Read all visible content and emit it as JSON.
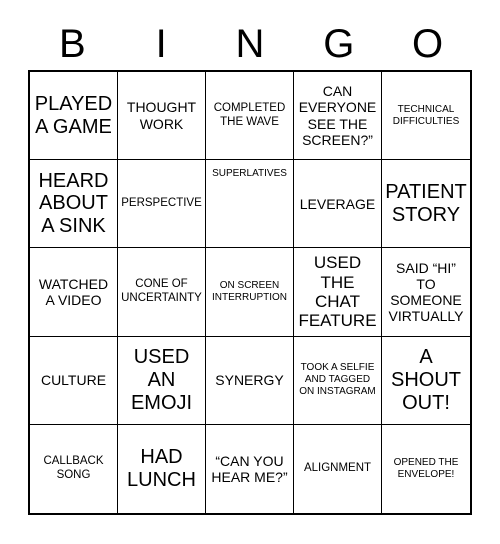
{
  "card": {
    "title": "BINGO",
    "header_letters": [
      "B",
      "I",
      "N",
      "G",
      "O"
    ],
    "columns": 5,
    "rows": 5,
    "colors": {
      "background": "#ffffff",
      "text": "#000000",
      "grid_line": "#000000"
    },
    "cells": [
      [
        {
          "text": "PLAYED A GAME",
          "size": "sz-xl",
          "align": "va-center"
        },
        {
          "text": "THOUGHT WORK",
          "size": "sz-md",
          "align": "va-center"
        },
        {
          "text": "COMPLETED THE WAVE",
          "size": "sz-sm",
          "align": "va-center"
        },
        {
          "text": "CAN EVERYONE SEE THE SCREEN?”",
          "size": "sz-md",
          "align": "va-center"
        },
        {
          "text": "TECHNICAL DIFFICULTIES",
          "size": "sz-xs",
          "align": "va-center"
        }
      ],
      [
        {
          "text": "HEARD ABOUT A SINK",
          "size": "sz-xl",
          "align": "va-center"
        },
        {
          "text": "PERSPECTIVE",
          "size": "sz-sm",
          "align": "va-center"
        },
        {
          "text": "SUPERLATIVES",
          "size": "sz-xs",
          "align": "va-top"
        },
        {
          "text": "LEVERAGE",
          "size": "sz-md",
          "align": "va-center"
        },
        {
          "text": "PATIENT STORY",
          "size": "sz-xl",
          "align": "va-center"
        }
      ],
      [
        {
          "text": "WATCHED A VIDEO",
          "size": "sz-md",
          "align": "va-center"
        },
        {
          "text": "CONE OF UNCERTAINTY",
          "size": "sz-sm",
          "align": "va-center"
        },
        {
          "text": "ON SCREEN INTERRUPTION",
          "size": "sz-xs",
          "align": "va-center"
        },
        {
          "text": "USED THE CHAT FEATURE",
          "size": "sz-lg",
          "align": "va-center"
        },
        {
          "text": "SAID “HI” TO SOMEONE VIRTUALLY",
          "size": "sz-md",
          "align": "va-center"
        }
      ],
      [
        {
          "text": "CULTURE",
          "size": "sz-md",
          "align": "va-center"
        },
        {
          "text": "USED AN EMOJI",
          "size": "sz-xl",
          "align": "va-center"
        },
        {
          "text": "SYNERGY",
          "size": "sz-md",
          "align": "va-center"
        },
        {
          "text": "TOOK A SELFIE AND TAGGED ON INSTAGRAM",
          "size": "sz-xs",
          "align": "va-center"
        },
        {
          "text": "A SHOUT OUT!",
          "size": "sz-xl",
          "align": "va-center"
        }
      ],
      [
        {
          "text": "CALLBACK SONG",
          "size": "sz-sm",
          "align": "va-center"
        },
        {
          "text": "HAD LUNCH",
          "size": "sz-xl",
          "align": "va-center"
        },
        {
          "text": "“CAN YOU HEAR ME?”",
          "size": "sz-md",
          "align": "va-center"
        },
        {
          "text": "ALIGNMENT",
          "size": "sz-sm",
          "align": "va-center"
        },
        {
          "text": "OPENED THE ENVELOPE!",
          "size": "sz-xs",
          "align": "va-center"
        }
      ]
    ]
  }
}
